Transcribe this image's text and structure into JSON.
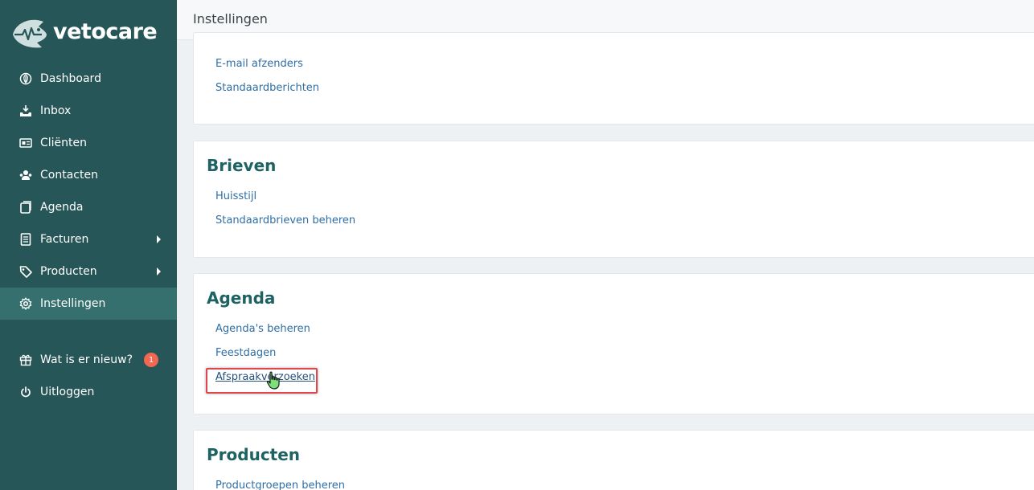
{
  "brand": {
    "name": "vetocare",
    "logo_icon": "fish-heartbeat-logo"
  },
  "sidebar": {
    "items": [
      {
        "label": "Dashboard",
        "icon": "leaf-icon"
      },
      {
        "label": "Inbox",
        "icon": "inbox-icon"
      },
      {
        "label": "Cliënten",
        "icon": "id-card-icon"
      },
      {
        "label": "Contacten",
        "icon": "users-icon"
      },
      {
        "label": "Agenda",
        "icon": "calendar-icon"
      },
      {
        "label": "Facturen",
        "icon": "invoice-icon",
        "has_submenu": true
      },
      {
        "label": "Producten",
        "icon": "tag-icon",
        "has_submenu": true
      },
      {
        "label": "Instellingen",
        "icon": "gear-icon",
        "active": true
      }
    ],
    "bottom_items": [
      {
        "label": "Wat is er nieuw?",
        "icon": "gift-icon",
        "badge": "1"
      },
      {
        "label": "Uitloggen",
        "icon": "power-icon"
      }
    ]
  },
  "header": {
    "title": "Instellingen"
  },
  "sections": [
    {
      "title": "",
      "links": [
        "E-mail afzenders",
        "Standaardberichten"
      ]
    },
    {
      "title": "Brieven",
      "links": [
        "Huisstijl",
        "Standaardbrieven beheren"
      ]
    },
    {
      "title": "Agenda",
      "links": [
        "Agenda's beheren",
        "Feestdagen",
        "Afspraakverzoeken"
      ]
    },
    {
      "title": "Producten",
      "links": [
        "Productgroepen beheren"
      ]
    }
  ],
  "colors": {
    "sidebar_bg": "#265657",
    "sidebar_active": "#35706f",
    "section_title": "#1e6263",
    "link": "#2f6ea4",
    "badge": "#f1674f",
    "highlight": "#e0474c"
  }
}
